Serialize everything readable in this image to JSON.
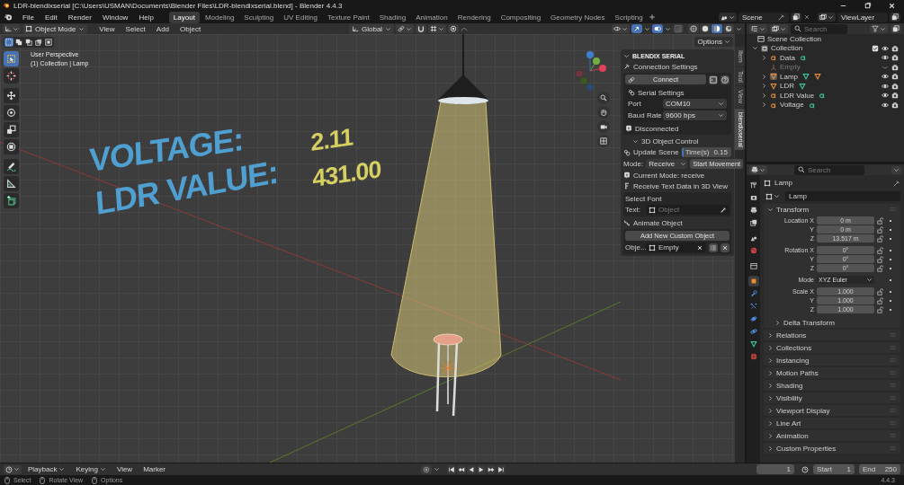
{
  "window": {
    "title": "LDR-blendixserial [C:\\Users\\USMAN\\Documents\\Blender Files\\LDR-blendixserial.blend] - Blender 4.4.3"
  },
  "menu": [
    "File",
    "Edit",
    "Render",
    "Window",
    "Help"
  ],
  "workspaces": [
    {
      "label": "Layout",
      "selected": true
    },
    {
      "label": "Modeling",
      "selected": false
    },
    {
      "label": "Sculpting",
      "selected": false
    },
    {
      "label": "UV Editing",
      "selected": false
    },
    {
      "label": "Texture Paint",
      "selected": false
    },
    {
      "label": "Shading",
      "selected": false
    },
    {
      "label": "Animation",
      "selected": false
    },
    {
      "label": "Rendering",
      "selected": false
    },
    {
      "label": "Compositing",
      "selected": false
    },
    {
      "label": "Geometry Nodes",
      "selected": false
    },
    {
      "label": "Scripting",
      "selected": false
    }
  ],
  "scene": "Scene",
  "view_layer": "ViewLayer",
  "viewport_header": {
    "mode": "Object Mode",
    "menus": [
      "View",
      "Select",
      "Add",
      "Object"
    ],
    "orientation": "Global",
    "shading": [
      {
        "kind": "wireframe",
        "selected": false
      },
      {
        "kind": "solid",
        "selected": false
      },
      {
        "kind": "material",
        "selected": true
      },
      {
        "kind": "rendered",
        "selected": false
      }
    ]
  },
  "viewport": {
    "options": "Options",
    "select_modes": [
      {
        "selected": true
      },
      {
        "selected": false
      },
      {
        "selected": false
      },
      {
        "selected": false
      },
      {
        "selected": false
      }
    ],
    "overlay_text": [
      "User Perspective",
      "(1) Collection | Lamp"
    ],
    "tools": [
      {
        "kind": "select",
        "selected": true
      },
      {
        "kind": "cursor",
        "selected": false
      },
      {
        "kind": "move",
        "selected": false
      },
      {
        "kind": "rotate",
        "selected": false
      },
      {
        "kind": "scale",
        "selected": false
      },
      {
        "kind": "transform",
        "selected": false
      },
      {
        "kind": "annotate",
        "selected": false
      },
      {
        "kind": "measure",
        "selected": false
      },
      {
        "kind": "add_cube",
        "selected": false
      }
    ],
    "scene_text": [
      {
        "label": "VOLTAGE:",
        "value": "2.11"
      },
      {
        "label": "LDR VALUE:",
        "value": "431.00"
      }
    ]
  },
  "sidebar": {
    "title": "BLENDIX SERIAL",
    "connection_title": "Connection Settings",
    "connect": "Connect",
    "serial_title": "Serial Settings",
    "fields": [
      {
        "label": "Port",
        "value": "COM10"
      },
      {
        "label": "Baud Rate",
        "value": "9600 bps"
      }
    ],
    "status": "Disconnected",
    "control_title": "3D Object Control",
    "update_scene": "Update Scene",
    "time": {
      "label": "Time(s)",
      "value": "0.15",
      "level": 0.05
    },
    "mode_label": "Mode:",
    "mode": "Receive",
    "start": "Start Movement",
    "current_mode": "Current Mode: receive",
    "receive_text": "Receive Text Data in 3D View",
    "font_title": "Select Font",
    "text_label": "Text:",
    "text_placeholder": "Object",
    "animate_title": "Animate Object",
    "add_custom": "Add New Custom Object",
    "object_label": "Obje...",
    "object_value": "Empty"
  },
  "side_tabs": [
    {
      "label": "Item",
      "selected": false
    },
    {
      "label": "Tool",
      "selected": false
    },
    {
      "label": "View",
      "selected": false
    },
    {
      "label": "blendixserial",
      "selected": true
    }
  ],
  "outliner": {
    "search_placeholder": "Search",
    "root": "Scene Collection",
    "collection": {
      "label": "Collection",
      "expanded": true,
      "checked": true,
      "children": [
        {
          "label": "Data",
          "kind": "text",
          "extras": [
            {
              "kind": "text"
            }
          ],
          "selected": false,
          "hidden": false,
          "expanded": false
        },
        {
          "label": "Empty",
          "kind": "empty",
          "selected": false,
          "hidden": true
        },
        {
          "label": "Lamp",
          "kind": "mesh",
          "extras": [
            {
              "kind": "mesh"
            },
            {
              "kind": "material"
            }
          ],
          "selected": true,
          "hidden": false,
          "expanded": false
        },
        {
          "label": "LDR",
          "kind": "mesh",
          "extras": [
            {
              "kind": "mesh"
            }
          ],
          "selected": false,
          "hidden": false,
          "expanded": false
        },
        {
          "label": "LDR Value",
          "kind": "text",
          "extras": [
            {
              "kind": "text"
            }
          ],
          "selected": false,
          "hidden": false,
          "expanded": false
        },
        {
          "label": "Voltage",
          "kind": "text",
          "extras": [
            {
              "kind": "text"
            }
          ],
          "selected": false,
          "hidden": false,
          "expanded": false
        }
      ]
    }
  },
  "properties": {
    "search_placeholder": "Search",
    "object": "Lamp",
    "object_name": "Lamp",
    "tabs": [
      {
        "kind": "tool",
        "selected": false
      },
      {
        "kind": "render",
        "selected": false
      },
      {
        "kind": "output",
        "selected": false
      },
      {
        "kind": "view_layer",
        "selected": false
      },
      {
        "kind": "scene",
        "selected": false
      },
      {
        "kind": "world",
        "selected": false
      },
      {
        "kind": "collection",
        "selected": false
      },
      {
        "kind": "object",
        "selected": true
      },
      {
        "kind": "modifiers",
        "selected": false
      },
      {
        "kind": "particles",
        "selected": false
      },
      {
        "kind": "physics",
        "selected": false
      },
      {
        "kind": "constraints",
        "selected": false
      },
      {
        "kind": "data",
        "selected": false
      },
      {
        "kind": "material",
        "selected": false
      }
    ],
    "panels": [
      {
        "title": "Transform",
        "expanded": true,
        "groups": [
          {
            "kind": "number",
            "rows": [
              {
                "label": "Location X",
                "value": "0 m"
              },
              {
                "label": "Y",
                "value": "0 m"
              },
              {
                "label": "Z",
                "value": "13.517 m"
              }
            ]
          },
          {
            "kind": "number",
            "rows": [
              {
                "label": "Rotation X",
                "value": "0°"
              },
              {
                "label": "Y",
                "value": "0°"
              },
              {
                "label": "Z",
                "value": "0°"
              }
            ]
          },
          {
            "kind": "dropdown",
            "rows": [
              {
                "label": "Mode",
                "value": "XYZ Euler"
              }
            ]
          },
          {
            "kind": "number",
            "rows": [
              {
                "label": "Scale X",
                "value": "1.000"
              },
              {
                "label": "Y",
                "value": "1.000"
              },
              {
                "label": "Z",
                "value": "1.000"
              }
            ]
          }
        ],
        "subpanels": [
          {
            "title": "Delta Transform",
            "expanded": false
          }
        ]
      },
      {
        "title": "Relations",
        "expanded": false
      },
      {
        "title": "Collections",
        "expanded": false
      },
      {
        "title": "Instancing",
        "expanded": false
      },
      {
        "title": "Motion Paths",
        "expanded": false
      },
      {
        "title": "Shading",
        "expanded": false
      },
      {
        "title": "Visibility",
        "expanded": false
      },
      {
        "title": "Viewport Display",
        "expanded": false
      },
      {
        "title": "Line Art",
        "expanded": false
      },
      {
        "title": "Animation",
        "expanded": false
      },
      {
        "title": "Custom Properties",
        "expanded": false
      }
    ]
  },
  "timeline": {
    "menus": [
      "Playback",
      "Keying",
      "View",
      "Marker"
    ],
    "frame": "1",
    "start_label": "Start",
    "start": "1",
    "end_label": "End",
    "end": "250"
  },
  "status_bar": {
    "hints": [
      "Select",
      "Rotate View",
      "Options"
    ],
    "version": "4.4.3"
  }
}
